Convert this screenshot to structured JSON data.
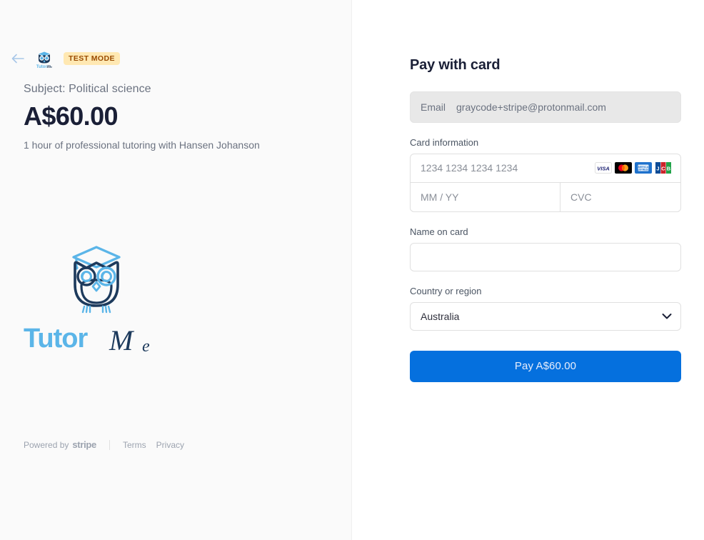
{
  "colors": {
    "accent_blue": "#0570de",
    "panel_bg": "#fafafa",
    "badge_bg": "#ffe8b2",
    "badge_text": "#9a4b00",
    "logo_light_blue": "#5bb5e8",
    "logo_navy": "#1d3a5c"
  },
  "left": {
    "back_icon": "back-arrow-icon",
    "merchant_logo": "tutorme-logo-icon",
    "test_badge": "TEST MODE",
    "subject": "Subject: Political science",
    "amount": "A$60.00",
    "description": "1 hour of professional tutoring with Hansen Johanson",
    "logo_wordmark_primary": "Tutor",
    "logo_wordmark_secondary": "Me",
    "footer": {
      "powered_by": "Powered by",
      "stripe": "stripe",
      "terms": "Terms",
      "privacy": "Privacy"
    }
  },
  "right": {
    "title": "Pay with card",
    "email": {
      "label": "Email",
      "value": "graycode+stripe@protonmail.com"
    },
    "card_information": {
      "label": "Card information",
      "number_placeholder": "1234 1234 1234 1234",
      "number_value": "",
      "expiry_placeholder": "MM / YY",
      "expiry_value": "",
      "cvc_placeholder": "CVC",
      "cvc_value": "",
      "brands": [
        "visa",
        "mastercard",
        "amex",
        "jcb"
      ]
    },
    "name_on_card": {
      "label": "Name on card",
      "value": "",
      "placeholder": ""
    },
    "country": {
      "label": "Country or region",
      "selected": "Australia"
    },
    "pay_button": "Pay A$60.00"
  }
}
